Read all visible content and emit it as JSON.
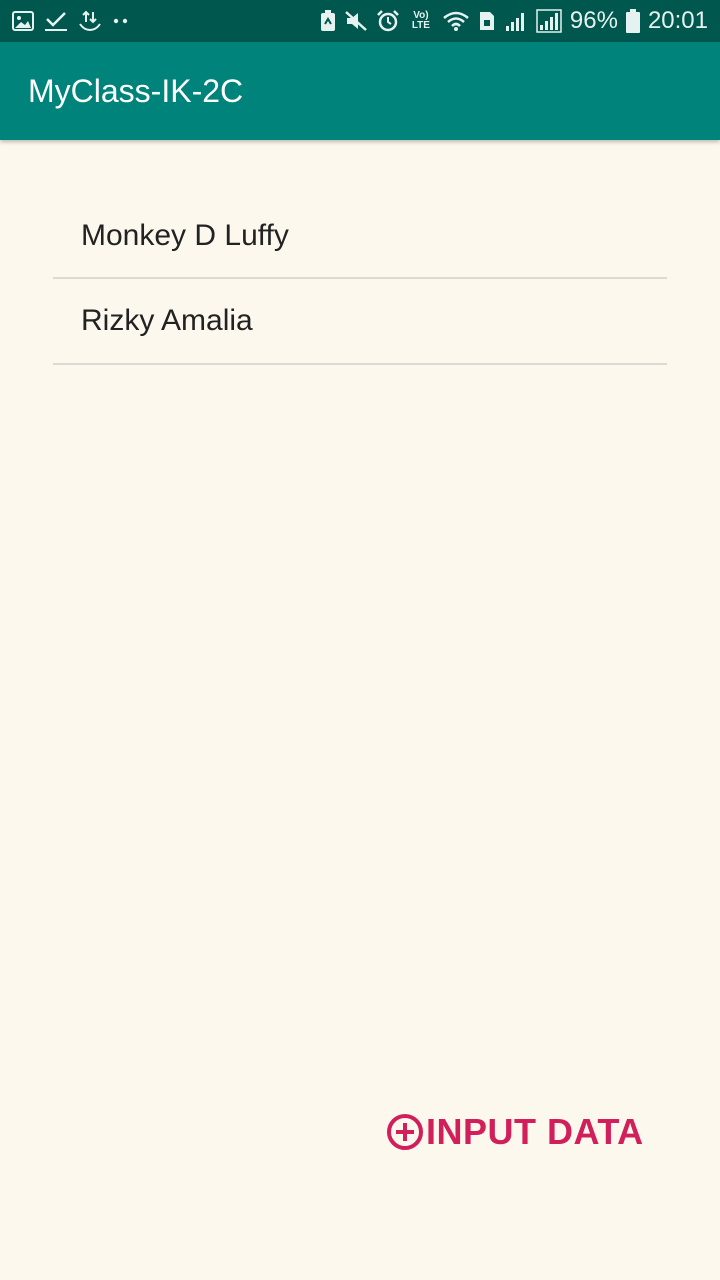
{
  "status_bar": {
    "battery_percent": "96%",
    "time": "20:01",
    "network_label": "Vo) LTE",
    "icons": [
      "image-icon",
      "check-icon",
      "usb-sync-icon",
      "dots-icon",
      "battery-saver-icon",
      "mute-icon",
      "alarm-icon",
      "volte-icon",
      "wifi-icon",
      "sim-icon",
      "signal-icon",
      "signal-icon",
      "battery-icon"
    ]
  },
  "app_bar": {
    "title": "MyClass-IK-2C"
  },
  "list": {
    "items": [
      {
        "label": "Monkey D Luffy"
      },
      {
        "label": "Rizky Amalia"
      }
    ]
  },
  "action": {
    "label": "INPUT DATA",
    "icon": "add-circle-icon"
  },
  "colors": {
    "status_bar": "#00574E",
    "app_bar": "#00837A",
    "background": "#FCF8EE",
    "accent": "#D01F5B",
    "divider": "#DCDAD4"
  }
}
